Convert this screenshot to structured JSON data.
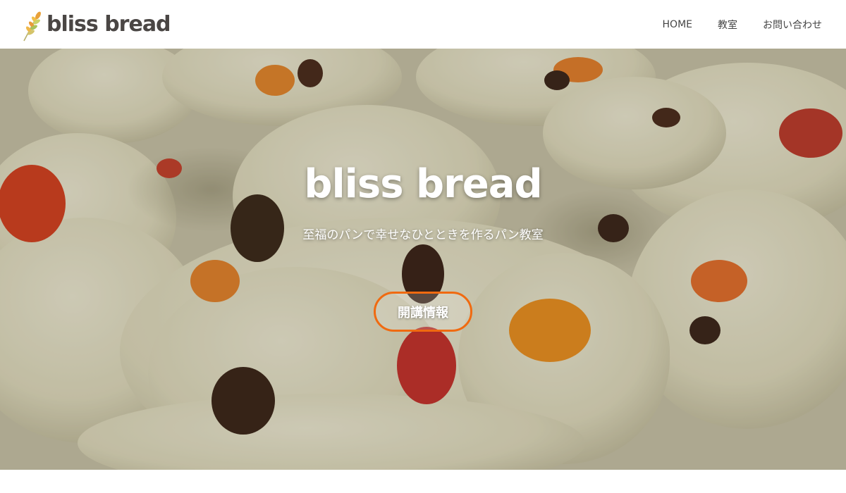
{
  "header": {
    "logo_text": "bliss bread",
    "nav": [
      {
        "label": "HOME"
      },
      {
        "label": "教室"
      },
      {
        "label": "お問い合わせ"
      }
    ]
  },
  "hero": {
    "title": "bliss bread",
    "subtitle": "至福のパンで幸せなひとときを作るパン教室",
    "cta_label": "開講情報"
  },
  "colors": {
    "accent": "#f06a10",
    "logo_text": "#4a4644",
    "nav_text": "#444444",
    "dough": "#e6e2c4"
  },
  "icons": {
    "logo_mark": "wheat-icon"
  }
}
